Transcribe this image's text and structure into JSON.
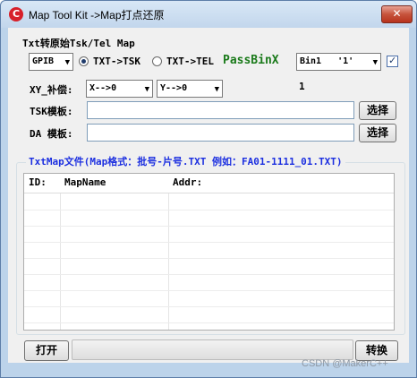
{
  "window": {
    "title": "Map Tool Kit ->Map打点还原",
    "icon": "C",
    "close": "✕"
  },
  "header_label": "Txt转原始Tsk/Tel  Map",
  "format_combo": {
    "value": "GPIB",
    "arrow": "▼"
  },
  "radio_tsk": {
    "label": "TXT->TSK",
    "selected": true
  },
  "radio_tel": {
    "label": "TXT->TEL",
    "selected": false
  },
  "passbin": {
    "text": "PassBinX",
    "color": "#1a7a1a"
  },
  "bin_combo": {
    "value": "Bin1   '1'",
    "arrow": "▼"
  },
  "checkbox": {
    "checked": true,
    "mark": "✓"
  },
  "xy_label": "XY_补偿:",
  "x_combo": {
    "value": "X-->0",
    "arrow": "▼"
  },
  "y_combo": {
    "value": "Y-->0",
    "arrow": "▼"
  },
  "counter": "1",
  "tsk_template": {
    "label": "TSK模板:",
    "value": "",
    "button": "选择"
  },
  "da_template": {
    "label": "DA 模板:",
    "value": "",
    "button": "选择"
  },
  "group_title": "TxtMap文件(Map格式：批号-片号.TXT 例如：FA01-1111_01.TXT)",
  "list_columns": [
    "ID:",
    "MapName",
    "Addr:"
  ],
  "open_button": "打开",
  "convert_button": "转换",
  "progress": 0,
  "watermark": "CSDN @MakerC++"
}
